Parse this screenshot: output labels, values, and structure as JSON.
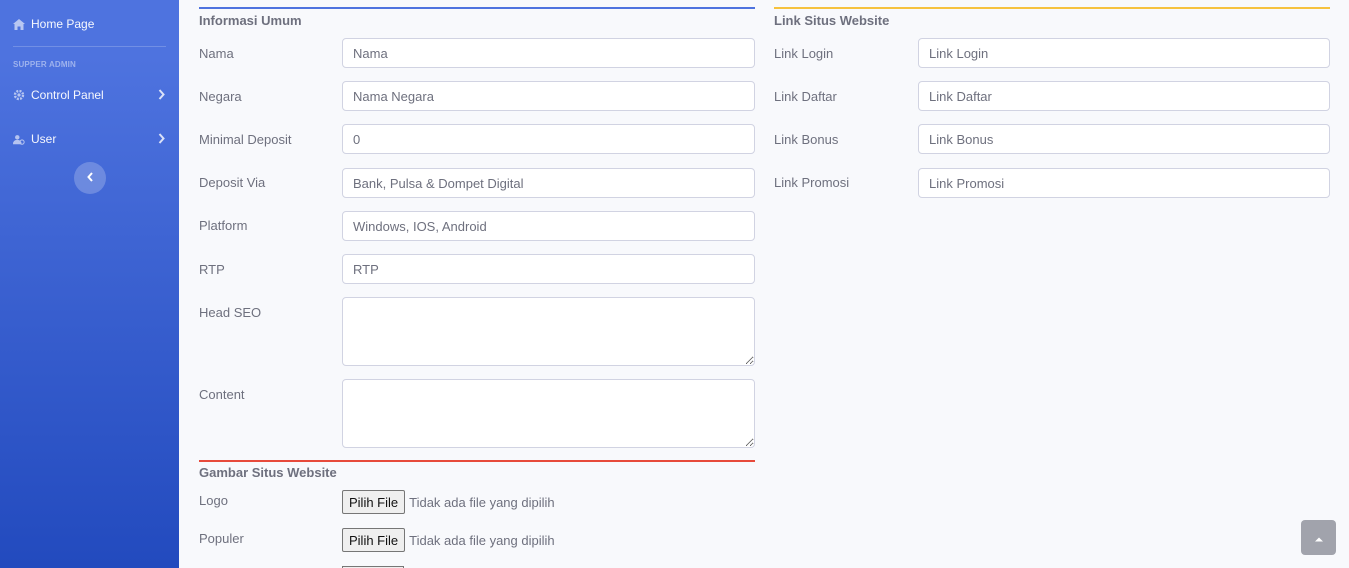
{
  "sidebar": {
    "home": "Home Page",
    "heading": "SUPPER ADMIN",
    "control_panel": "Control Panel",
    "user": "User"
  },
  "informasi": {
    "title": "Informasi Umum",
    "color": "#4e73df",
    "fields": [
      {
        "label": "Nama",
        "placeholder": "Nama",
        "value": ""
      },
      {
        "label": "Negara",
        "placeholder": "Nama Negara",
        "value": ""
      },
      {
        "label": "Minimal Deposit",
        "placeholder": "",
        "value": "0"
      },
      {
        "label": "Deposit Via",
        "placeholder": "Bank, Pulsa & Dompet Digital",
        "value": ""
      },
      {
        "label": "Platform",
        "placeholder": "Windows, IOS, Android",
        "value": ""
      },
      {
        "label": "RTP",
        "placeholder": "RTP",
        "value": ""
      },
      {
        "label": "Head SEO",
        "placeholder": "",
        "value": ""
      },
      {
        "label": "Content",
        "placeholder": "",
        "value": ""
      }
    ]
  },
  "link": {
    "title": "Link Situs Website",
    "color": "#f6c23e",
    "fields": [
      {
        "label": "Link Login",
        "placeholder": "Link Login"
      },
      {
        "label": "Link Daftar",
        "placeholder": "Link Daftar"
      },
      {
        "label": "Link Bonus",
        "placeholder": "Link Bonus"
      },
      {
        "label": "Link Promosi",
        "placeholder": "Link Promosi"
      }
    ]
  },
  "gambar": {
    "title": "Gambar Situs Website",
    "color": "#e74a3b",
    "button_label": "Pilih File",
    "no_file": "Tidak ada file yang dipilih",
    "fields": [
      {
        "label": "Logo"
      },
      {
        "label": "Populer"
      }
    ]
  }
}
